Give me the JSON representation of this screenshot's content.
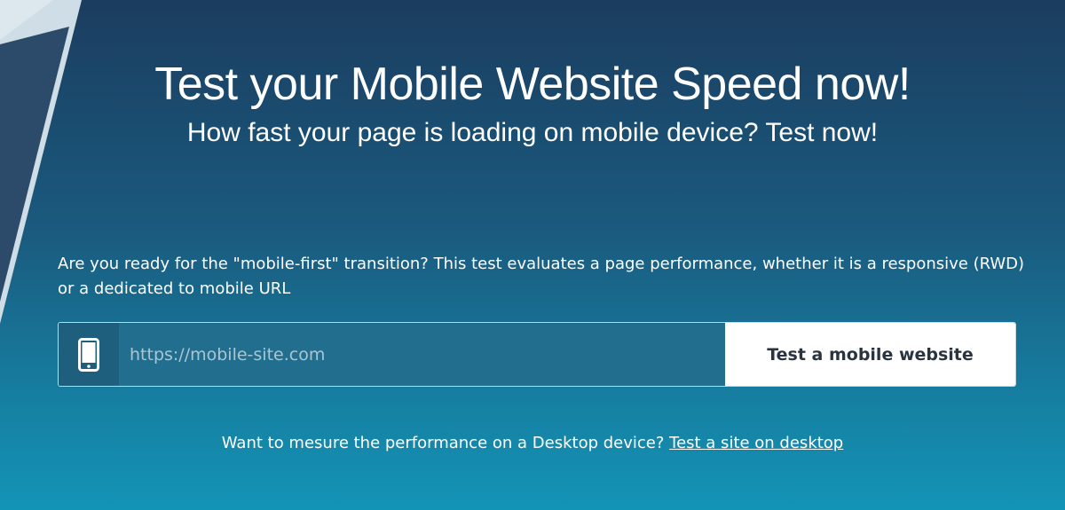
{
  "hero": {
    "title": "Test your Mobile Website Speed now!",
    "subtitle": "How fast your page is loading on mobile device? Test now!"
  },
  "intro": {
    "text": "Are you ready for the \"mobile-first\" transition? This test evaluates a page performance, whether it is a responsive (RWD) or a dedicated to mobile URL"
  },
  "form": {
    "device_icon": "mobile-phone-icon",
    "url_value": "",
    "url_placeholder": "https://mobile-site.com",
    "submit_label": "Test a mobile website"
  },
  "desktop_note": {
    "text": "Want to mesure the performance on a Desktop device?",
    "link_label": "Test a site on desktop"
  },
  "colors": {
    "background_top": "#1b3d5f",
    "background_bottom": "#1394b7",
    "button_bg": "#ffffff",
    "button_text": "#2a3440"
  }
}
